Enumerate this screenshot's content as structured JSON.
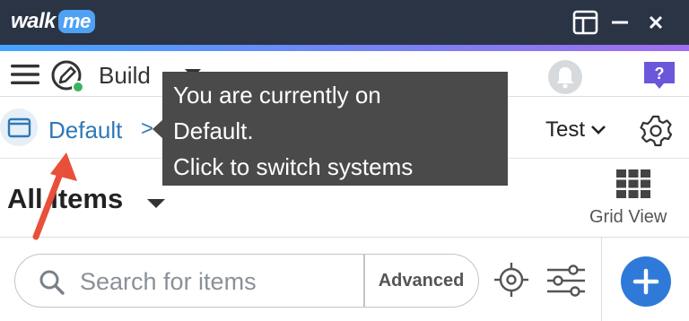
{
  "titlebar": {
    "logo_text": "walk",
    "logo_badge": "me",
    "icons": [
      "layout-panel-icon",
      "minimize-icon",
      "close-icon"
    ]
  },
  "toolbar": {
    "menu_icon": "hamburger-icon",
    "build_label": "Build",
    "icons": [
      "build-pencil-icon",
      "caret-down-icon",
      "bell-icon",
      "help-icon"
    ],
    "help_glyph": "?"
  },
  "system_bar": {
    "system_name": "Default",
    "separator": ">",
    "environment": "Test",
    "icons": [
      "window-icon",
      "chevron-down-icon",
      "gear-icon"
    ]
  },
  "tooltip": {
    "line1": "You are currently on",
    "line2": "Default.",
    "line3": "Click to switch systems"
  },
  "items": {
    "title": "All Items",
    "view_label": "Grid View",
    "icons": [
      "caret-down-icon",
      "grid-icon"
    ]
  },
  "search": {
    "placeholder": "Search for items",
    "value": "",
    "advanced_label": "Advanced",
    "icons": [
      "search-icon",
      "target-icon",
      "filter-sliders-icon",
      "plus-icon"
    ]
  },
  "colors": {
    "titlebar_bg": "#2b3445",
    "accent_blue": "#2f78b7",
    "help_purple": "#6b57d9",
    "add_button_blue": "#2f7ad8",
    "tooltip_bg": "#4a4a4a",
    "annotation_red": "#e8503a"
  }
}
